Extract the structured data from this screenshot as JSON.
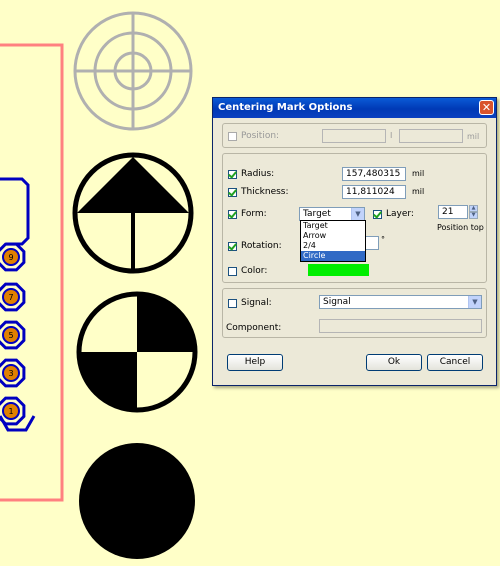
{
  "dialog": {
    "title": "Centering Mark Options",
    "close_glyph": "✕",
    "position": {
      "label": "Position:",
      "checked": false,
      "x_value": "",
      "separator": "I",
      "y_value": "",
      "unit": "mil"
    },
    "radius": {
      "label": "Radius:",
      "checked": true,
      "value": "157,480315",
      "unit": "mil"
    },
    "thickness": {
      "label": "Thickness:",
      "checked": true,
      "value": "11,811024",
      "unit": "mil"
    },
    "form": {
      "label": "Form:",
      "checked": true,
      "selected": "Target",
      "options": [
        "Target",
        "Arrow",
        "2/4",
        "Circle"
      ],
      "highlighted": "Circle"
    },
    "layer": {
      "label": "Layer:",
      "checked": true,
      "value": "21",
      "caption": "Position top"
    },
    "rotation": {
      "label": "Rotation:",
      "checked": true,
      "suffix": "°"
    },
    "color": {
      "label": "Color:",
      "checked": false,
      "swatch": "#00ee00"
    },
    "signal": {
      "label": "Signal:",
      "checked": false,
      "selected": "Signal"
    },
    "component": {
      "label": "Component:",
      "value": ""
    },
    "buttons": {
      "help": "Help",
      "ok": "Ok",
      "cancel": "Cancel"
    }
  },
  "colors": {
    "background": "#ffffc8",
    "board_outline": "#ff8080",
    "trace": "#0000c0",
    "pad": "#e08000",
    "target_mark": "#b0b0b0"
  },
  "pads": [
    "9",
    "7",
    "5",
    "3",
    "1"
  ]
}
